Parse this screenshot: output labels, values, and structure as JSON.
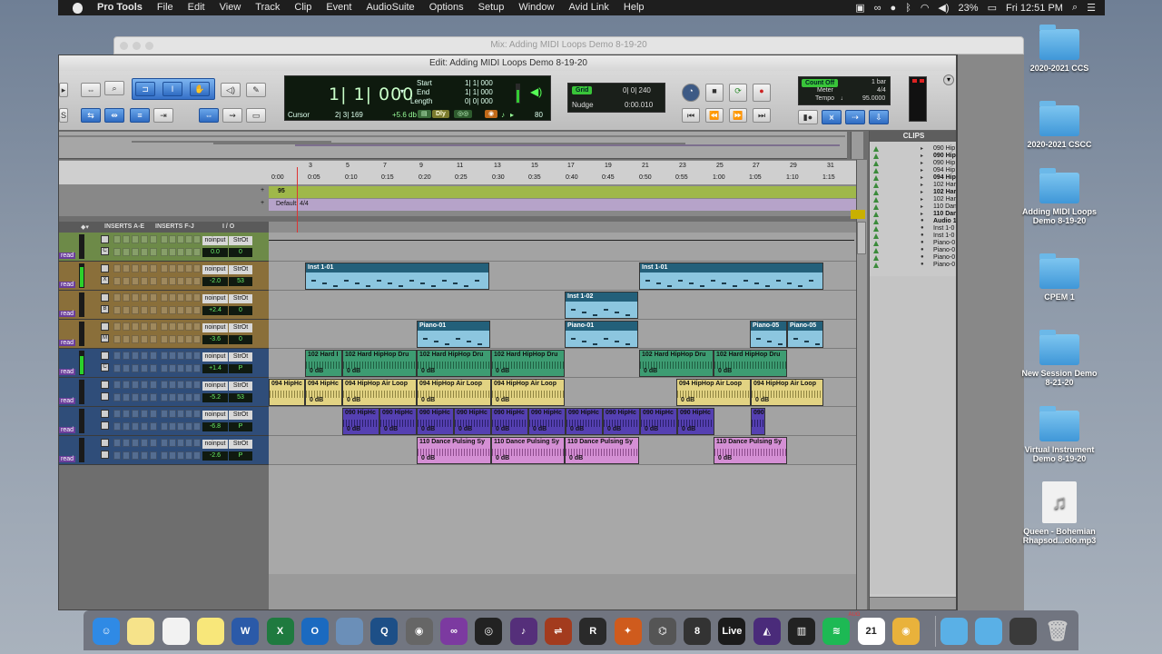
{
  "menubar": {
    "app": "Pro Tools",
    "items": [
      "File",
      "Edit",
      "View",
      "Track",
      "Clip",
      "Event",
      "AudioSuite",
      "Options",
      "Setup",
      "Window",
      "Avid Link",
      "Help"
    ],
    "battery": "23%",
    "clock": "Fri 12:51 PM"
  },
  "mix_window": {
    "title": "Mix: Adding MIDI Loops Demo 8-19-20"
  },
  "edit_window": {
    "title": "Edit: Adding MIDI Loops Demo 8-19-20",
    "counter": {
      "main": "1| 1| 000",
      "cursor_label": "Cursor",
      "cursor_value": "2| 3| 169",
      "start_label": "Start",
      "end_label": "End",
      "length_label": "Length",
      "start": "1| 1| 000",
      "end": "1| 1| 000",
      "length": "0| 0| 000",
      "level": "+5.6 db",
      "dly": "Dly",
      "nudge_num": "80"
    },
    "grid": {
      "label": "Grid",
      "value": "0| 0| 240",
      "nudge_label": "Nudge",
      "nudge_value": "0:00.010"
    },
    "transport_extra": {
      "count_off": "Count Off",
      "bar": "1 bar",
      "meter_label": "Meter",
      "meter_value": "4/4",
      "tempo_label": "Tempo",
      "tempo_value": "95.0000"
    }
  },
  "rulers": {
    "bars": [
      "3",
      "5",
      "7",
      "9",
      "11",
      "13",
      "15",
      "17",
      "19",
      "21",
      "23",
      "25",
      "27",
      "29",
      "31"
    ],
    "mins": [
      "0:00",
      "0:05",
      "0:10",
      "0:15",
      "0:20",
      "0:25",
      "0:30",
      "0:35",
      "0:40",
      "0:45",
      "0:50",
      "0:55",
      "1:00",
      "1:05",
      "1:10",
      "1:15"
    ],
    "tempo_marker": "95",
    "meter_marker": "Default: 4/4"
  },
  "columns": {
    "inserts_ae": "INSERTS A-E",
    "inserts_fj": "INSERTS F-J",
    "io": "I / O"
  },
  "tracks": [
    {
      "type": "first",
      "io": "noinput",
      "out": "StrOt",
      "vol": "0.0",
      "pan": "0",
      "btn": "C"
    },
    {
      "type": "midi",
      "io": "noinput",
      "out": "StrOt",
      "vol": "-2.0",
      "pan": "53",
      "btn": "X"
    },
    {
      "type": "midi",
      "io": "noinput",
      "out": "StrOt",
      "vol": "+2.4",
      "pan": "0",
      "btn": "B"
    },
    {
      "type": "midi",
      "io": "noinput",
      "out": "StrOt",
      "vol": "-3.6",
      "pan": "0",
      "btn": "M"
    },
    {
      "type": "audio",
      "io": "noinput",
      "out": "StrOt",
      "vol": "+1.4",
      "pan": "P",
      "btn": "C"
    },
    {
      "type": "audio",
      "io": "noinput",
      "out": "StrOt",
      "vol": "-5.2",
      "pan": "53",
      "btn": ""
    },
    {
      "type": "audio",
      "io": "noinput",
      "out": "StrOt",
      "vol": "-6.8",
      "pan": "P",
      "btn": ""
    },
    {
      "type": "audio",
      "io": "noinput",
      "out": "StrOt",
      "vol": "-2.6",
      "pan": "P",
      "btn": ""
    }
  ],
  "record_label": "read",
  "clips": {
    "inst101": "Inst 1-01",
    "inst102": "Inst 1-02",
    "piano01": "Piano-01",
    "piano05": "Piano-05",
    "drum": "102 Hard HipHop Dru",
    "drum_short": "102 Hard I",
    "air": "094 HipHop Air Loop",
    "air_short": "094 HipHc",
    "hh": "090 HipHc",
    "hh_short": "090",
    "dance": "110 Dance Pulsing Sy",
    "db": "0 dB"
  },
  "clips_list": {
    "header": "CLIPS",
    "items": [
      "090 Hip",
      "090 Hip",
      "090 Hip",
      "094 Hip",
      "094 Hip",
      "102 Har",
      "102 Har",
      "102 Har",
      "110 Dan",
      "110 Dan",
      "Audio 1",
      "Inst 1-0",
      "Inst 1-0",
      "Piano-0",
      "Piano-0",
      "Piano-0",
      "Piano-0"
    ]
  },
  "desktop": [
    {
      "label": "2020-2021 CCS",
      "kind": "folder"
    },
    {
      "label": "2020-2021 CSCC",
      "kind": "folder"
    },
    {
      "label": "Adding MIDI Loops Demo 8-19-20",
      "kind": "folder"
    },
    {
      "label": "CPEM 1",
      "kind": "folder"
    },
    {
      "label": "New Session Demo 8-21-20",
      "kind": "folder"
    },
    {
      "label": "Virtual Instrument Demo 8-19-20",
      "kind": "folder"
    },
    {
      "label": "Queen - Bohemian Rhapsod...olo.mp3",
      "kind": "music"
    }
  ],
  "dock": {
    "calendar_month": "AUG",
    "calendar_day": "21",
    "live": "Live",
    "office": [
      "W",
      "X",
      "O"
    ]
  }
}
